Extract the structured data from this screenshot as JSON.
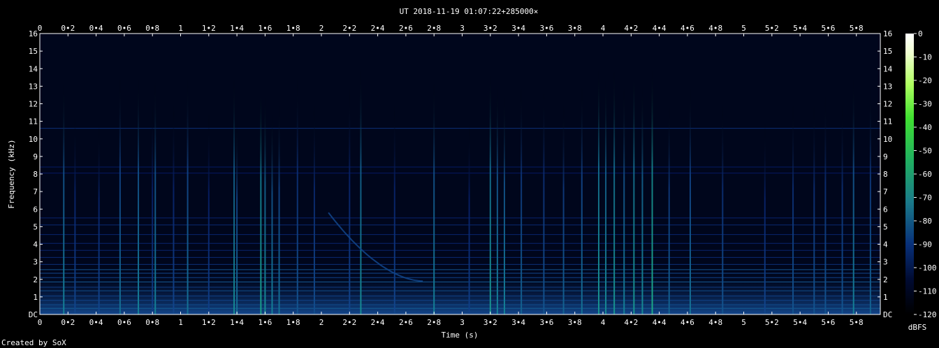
{
  "chart_data": {
    "type": "heatmap",
    "title": "UT 2018-11-19 01:07:22+285000×",
    "xlabel": "Time (s)",
    "ylabel": "Frequency (kHz)",
    "xlim": [
      0,
      5.97
    ],
    "ylim": [
      0,
      16
    ],
    "x_ticks": [
      "0",
      "0•2",
      "0•4",
      "0•6",
      "0•8",
      "1",
      "1•2",
      "1•4",
      "1•6",
      "1•8",
      "2",
      "2•2",
      "2•4",
      "2•6",
      "2•8",
      "3",
      "3•2",
      "3•4",
      "3•6",
      "3•8",
      "4",
      "4•2",
      "4•4",
      "4•6",
      "4•8",
      "5",
      "5•2",
      "5•4",
      "5•6",
      "5•8"
    ],
    "y_ticks": [
      "DC",
      "1",
      "2",
      "3",
      "4",
      "5",
      "6",
      "7",
      "8",
      "9",
      "10",
      "11",
      "12",
      "13",
      "14",
      "15",
      "16"
    ],
    "colorbar": {
      "label": "dBFS",
      "ticks": [
        "0",
        "-10",
        "-20",
        "-30",
        "-40",
        "-50",
        "-60",
        "-70",
        "-80",
        "-90",
        "-100",
        "-110",
        "-120"
      ],
      "range": [
        -120,
        0
      ]
    },
    "grid": false,
    "background_db": -112,
    "horizontal_lines": [
      {
        "f": 0.35,
        "db": -93
      },
      {
        "f": 0.55,
        "db": -95
      },
      {
        "f": 0.8,
        "db": -96
      },
      {
        "f": 1.05,
        "db": -97
      },
      {
        "f": 1.35,
        "db": -95
      },
      {
        "f": 1.55,
        "db": -98
      },
      {
        "f": 1.85,
        "db": -94
      },
      {
        "f": 2.1,
        "db": -97
      },
      {
        "f": 2.35,
        "db": -96
      },
      {
        "f": 2.55,
        "db": -94
      },
      {
        "f": 2.85,
        "db": -100
      },
      {
        "f": 3.25,
        "db": -101
      },
      {
        "f": 3.65,
        "db": -102
      },
      {
        "f": 4.05,
        "db": -102
      },
      {
        "f": 4.55,
        "db": -102
      },
      {
        "f": 5.1,
        "db": -101
      },
      {
        "f": 5.5,
        "db": -102
      },
      {
        "f": 8.05,
        "db": -104
      },
      {
        "f": 8.4,
        "db": -104
      },
      {
        "f": 10.6,
        "db": -100
      }
    ],
    "transients": [
      {
        "t": 0.17,
        "fmax": 13.3,
        "db": -88
      },
      {
        "t": 0.25,
        "fmax": 11.5,
        "db": -96
      },
      {
        "t": 0.42,
        "fmax": 11.0,
        "db": -96
      },
      {
        "t": 0.57,
        "fmax": 13.5,
        "db": -90
      },
      {
        "t": 0.7,
        "fmax": 13.5,
        "db": -88
      },
      {
        "t": 0.8,
        "fmax": 12.0,
        "db": -97
      },
      {
        "t": 0.82,
        "fmax": 13.3,
        "db": -88
      },
      {
        "t": 0.95,
        "fmax": 12.0,
        "db": -96
      },
      {
        "t": 1.05,
        "fmax": 13.5,
        "db": -90
      },
      {
        "t": 1.2,
        "fmax": 11.5,
        "db": -97
      },
      {
        "t": 1.38,
        "fmax": 13.5,
        "db": -86
      },
      {
        "t": 1.4,
        "fmax": 11.0,
        "db": -90
      },
      {
        "t": 1.57,
        "fmax": 13.0,
        "db": -82
      },
      {
        "t": 1.6,
        "fmax": 12.5,
        "db": -86
      },
      {
        "t": 1.65,
        "fmax": 11.5,
        "db": -88
      },
      {
        "t": 1.7,
        "fmax": 12.0,
        "db": -90
      },
      {
        "t": 1.83,
        "fmax": 13.5,
        "db": -94
      },
      {
        "t": 1.95,
        "fmax": 12.0,
        "db": -95
      },
      {
        "t": 2.2,
        "fmax": 13.0,
        "db": -96
      },
      {
        "t": 2.28,
        "fmax": 14.0,
        "db": -86
      },
      {
        "t": 2.52,
        "fmax": 12.0,
        "db": -96
      },
      {
        "t": 2.8,
        "fmax": 13.3,
        "db": -88
      },
      {
        "t": 3.05,
        "fmax": 11.0,
        "db": -97
      },
      {
        "t": 3.2,
        "fmax": 13.8,
        "db": -84
      },
      {
        "t": 3.25,
        "fmax": 13.0,
        "db": -88
      },
      {
        "t": 3.3,
        "fmax": 12.5,
        "db": -88
      },
      {
        "t": 3.42,
        "fmax": 13.0,
        "db": -92
      },
      {
        "t": 3.58,
        "fmax": 13.0,
        "db": -94
      },
      {
        "t": 3.72,
        "fmax": 12.0,
        "db": -92
      },
      {
        "t": 3.85,
        "fmax": 13.0,
        "db": -90
      },
      {
        "t": 3.97,
        "fmax": 14.0,
        "db": -84
      },
      {
        "t": 4.02,
        "fmax": 13.5,
        "db": -86
      },
      {
        "t": 4.08,
        "fmax": 14.0,
        "db": -84
      },
      {
        "t": 4.15,
        "fmax": 13.0,
        "db": -88
      },
      {
        "t": 4.22,
        "fmax": 14.0,
        "db": -84
      },
      {
        "t": 4.28,
        "fmax": 13.0,
        "db": -86
      },
      {
        "t": 4.35,
        "fmax": 14.0,
        "db": -80
      },
      {
        "t": 4.47,
        "fmax": 12.0,
        "db": -92
      },
      {
        "t": 4.62,
        "fmax": 13.0,
        "db": -90
      },
      {
        "t": 4.85,
        "fmax": 12.0,
        "db": -94
      },
      {
        "t": 5.15,
        "fmax": 11.0,
        "db": -96
      },
      {
        "t": 5.35,
        "fmax": 12.0,
        "db": -94
      },
      {
        "t": 5.5,
        "fmax": 12.0,
        "db": -94
      },
      {
        "t": 5.58,
        "fmax": 12.5,
        "db": -94
      },
      {
        "t": 5.7,
        "fmax": 12.0,
        "db": -94
      },
      {
        "t": 5.78,
        "fmax": 13.5,
        "db": -88
      },
      {
        "t": 5.9,
        "fmax": 13.0,
        "db": -92
      }
    ],
    "chirp": {
      "t_start": 2.05,
      "f_start": 5.8,
      "t_end": 2.72,
      "f_end": 1.9,
      "db": -96
    }
  },
  "footer": {
    "credit": "Created by SoX"
  }
}
